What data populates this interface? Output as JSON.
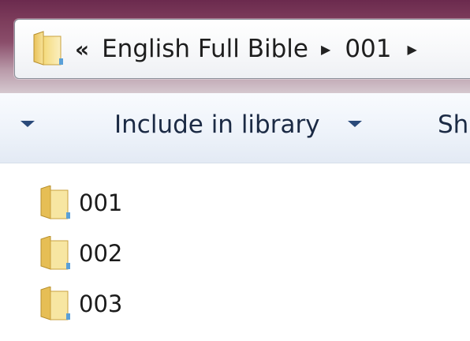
{
  "address_bar": {
    "overflow_label": "«",
    "crumbs": [
      "English Full Bible",
      "001"
    ]
  },
  "toolbar": {
    "include_label": "Include in library",
    "share_label": "Sh"
  },
  "files": [
    {
      "name": "001",
      "icon": "folder-icon"
    },
    {
      "name": "002",
      "icon": "folder-icon"
    },
    {
      "name": "003",
      "icon": "folder-icon"
    }
  ]
}
